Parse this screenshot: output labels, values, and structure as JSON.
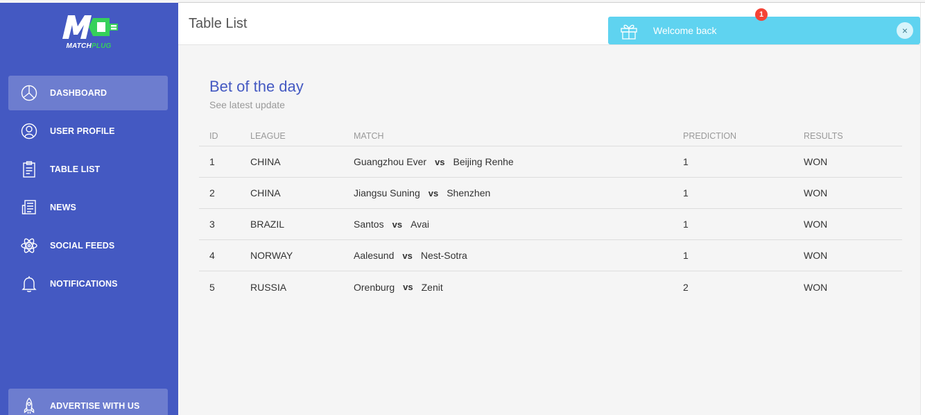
{
  "brand": {
    "logo_letters": "M",
    "name_part1": "MATCH",
    "name_part2": "PLUG",
    "accent": "#35d05a"
  },
  "sidebar": {
    "background": "#4459c2",
    "items": [
      {
        "label": "DASHBOARD",
        "icon": "pie-chart-icon",
        "active": true
      },
      {
        "label": "USER PROFILE",
        "icon": "user-icon",
        "active": false
      },
      {
        "label": "TABLE LIST",
        "icon": "clipboard-icon",
        "active": false
      },
      {
        "label": "NEWS",
        "icon": "newspaper-icon",
        "active": false
      },
      {
        "label": "SOCIAL FEEDS",
        "icon": "atom-icon",
        "active": false
      },
      {
        "label": "NOTIFICATIONS",
        "icon": "bell-icon",
        "active": false
      }
    ],
    "footer_item": {
      "label": "ADVERTISE WITH US",
      "icon": "rocket-icon"
    }
  },
  "header": {
    "title": "Table List",
    "notification_count": "1"
  },
  "toast": {
    "text": "Welcome back",
    "close": "×",
    "icon": "gift-icon",
    "color": "#5fd3f0"
  },
  "card": {
    "title": "Bet of the day",
    "subtitle": "See latest update",
    "columns": [
      "ID",
      "LEAGUE",
      "MATCH",
      "PREDICTION",
      "RESULTS"
    ],
    "vs_label": "vs",
    "rows": [
      {
        "id": "1",
        "league": "CHINA",
        "home": "Guangzhou Ever",
        "away": "Beijing Renhe",
        "prediction": "1",
        "result": "WON"
      },
      {
        "id": "2",
        "league": "CHINA",
        "home": "Jiangsu Suning",
        "away": "Shenzhen",
        "prediction": "1",
        "result": "WON"
      },
      {
        "id": "3",
        "league": "BRAZIL",
        "home": "Santos",
        "away": "Avai",
        "prediction": "1",
        "result": "WON"
      },
      {
        "id": "4",
        "league": "NORWAY",
        "home": "Aalesund",
        "away": "Nest-Sotra",
        "prediction": "1",
        "result": "WON"
      },
      {
        "id": "5",
        "league": "RUSSIA",
        "home": "Orenburg",
        "away": "Zenit",
        "prediction": "2",
        "result": "WON"
      }
    ]
  }
}
